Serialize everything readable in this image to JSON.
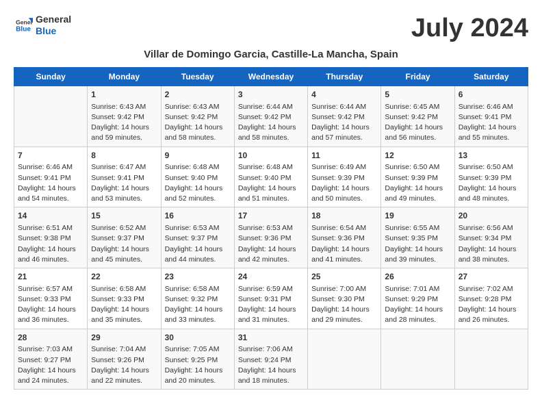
{
  "logo": {
    "line1": "General",
    "line2": "Blue"
  },
  "title": "July 2024",
  "subtitle": "Villar de Domingo Garcia, Castille-La Mancha, Spain",
  "days_of_week": [
    "Sunday",
    "Monday",
    "Tuesday",
    "Wednesday",
    "Thursday",
    "Friday",
    "Saturday"
  ],
  "weeks": [
    [
      {
        "day": "",
        "info": ""
      },
      {
        "day": "1",
        "info": "Sunrise: 6:43 AM\nSunset: 9:42 PM\nDaylight: 14 hours\nand 59 minutes."
      },
      {
        "day": "2",
        "info": "Sunrise: 6:43 AM\nSunset: 9:42 PM\nDaylight: 14 hours\nand 58 minutes."
      },
      {
        "day": "3",
        "info": "Sunrise: 6:44 AM\nSunset: 9:42 PM\nDaylight: 14 hours\nand 58 minutes."
      },
      {
        "day": "4",
        "info": "Sunrise: 6:44 AM\nSunset: 9:42 PM\nDaylight: 14 hours\nand 57 minutes."
      },
      {
        "day": "5",
        "info": "Sunrise: 6:45 AM\nSunset: 9:42 PM\nDaylight: 14 hours\nand 56 minutes."
      },
      {
        "day": "6",
        "info": "Sunrise: 6:46 AM\nSunset: 9:41 PM\nDaylight: 14 hours\nand 55 minutes."
      }
    ],
    [
      {
        "day": "7",
        "info": "Sunrise: 6:46 AM\nSunset: 9:41 PM\nDaylight: 14 hours\nand 54 minutes."
      },
      {
        "day": "8",
        "info": "Sunrise: 6:47 AM\nSunset: 9:41 PM\nDaylight: 14 hours\nand 53 minutes."
      },
      {
        "day": "9",
        "info": "Sunrise: 6:48 AM\nSunset: 9:40 PM\nDaylight: 14 hours\nand 52 minutes."
      },
      {
        "day": "10",
        "info": "Sunrise: 6:48 AM\nSunset: 9:40 PM\nDaylight: 14 hours\nand 51 minutes."
      },
      {
        "day": "11",
        "info": "Sunrise: 6:49 AM\nSunset: 9:39 PM\nDaylight: 14 hours\nand 50 minutes."
      },
      {
        "day": "12",
        "info": "Sunrise: 6:50 AM\nSunset: 9:39 PM\nDaylight: 14 hours\nand 49 minutes."
      },
      {
        "day": "13",
        "info": "Sunrise: 6:50 AM\nSunset: 9:39 PM\nDaylight: 14 hours\nand 48 minutes."
      }
    ],
    [
      {
        "day": "14",
        "info": "Sunrise: 6:51 AM\nSunset: 9:38 PM\nDaylight: 14 hours\nand 46 minutes."
      },
      {
        "day": "15",
        "info": "Sunrise: 6:52 AM\nSunset: 9:37 PM\nDaylight: 14 hours\nand 45 minutes."
      },
      {
        "day": "16",
        "info": "Sunrise: 6:53 AM\nSunset: 9:37 PM\nDaylight: 14 hours\nand 44 minutes."
      },
      {
        "day": "17",
        "info": "Sunrise: 6:53 AM\nSunset: 9:36 PM\nDaylight: 14 hours\nand 42 minutes."
      },
      {
        "day": "18",
        "info": "Sunrise: 6:54 AM\nSunset: 9:36 PM\nDaylight: 14 hours\nand 41 minutes."
      },
      {
        "day": "19",
        "info": "Sunrise: 6:55 AM\nSunset: 9:35 PM\nDaylight: 14 hours\nand 39 minutes."
      },
      {
        "day": "20",
        "info": "Sunrise: 6:56 AM\nSunset: 9:34 PM\nDaylight: 14 hours\nand 38 minutes."
      }
    ],
    [
      {
        "day": "21",
        "info": "Sunrise: 6:57 AM\nSunset: 9:33 PM\nDaylight: 14 hours\nand 36 minutes."
      },
      {
        "day": "22",
        "info": "Sunrise: 6:58 AM\nSunset: 9:33 PM\nDaylight: 14 hours\nand 35 minutes."
      },
      {
        "day": "23",
        "info": "Sunrise: 6:58 AM\nSunset: 9:32 PM\nDaylight: 14 hours\nand 33 minutes."
      },
      {
        "day": "24",
        "info": "Sunrise: 6:59 AM\nSunset: 9:31 PM\nDaylight: 14 hours\nand 31 minutes."
      },
      {
        "day": "25",
        "info": "Sunrise: 7:00 AM\nSunset: 9:30 PM\nDaylight: 14 hours\nand 29 minutes."
      },
      {
        "day": "26",
        "info": "Sunrise: 7:01 AM\nSunset: 9:29 PM\nDaylight: 14 hours\nand 28 minutes."
      },
      {
        "day": "27",
        "info": "Sunrise: 7:02 AM\nSunset: 9:28 PM\nDaylight: 14 hours\nand 26 minutes."
      }
    ],
    [
      {
        "day": "28",
        "info": "Sunrise: 7:03 AM\nSunset: 9:27 PM\nDaylight: 14 hours\nand 24 minutes."
      },
      {
        "day": "29",
        "info": "Sunrise: 7:04 AM\nSunset: 9:26 PM\nDaylight: 14 hours\nand 22 minutes."
      },
      {
        "day": "30",
        "info": "Sunrise: 7:05 AM\nSunset: 9:25 PM\nDaylight: 14 hours\nand 20 minutes."
      },
      {
        "day": "31",
        "info": "Sunrise: 7:06 AM\nSunset: 9:24 PM\nDaylight: 14 hours\nand 18 minutes."
      },
      {
        "day": "",
        "info": ""
      },
      {
        "day": "",
        "info": ""
      },
      {
        "day": "",
        "info": ""
      }
    ]
  ]
}
